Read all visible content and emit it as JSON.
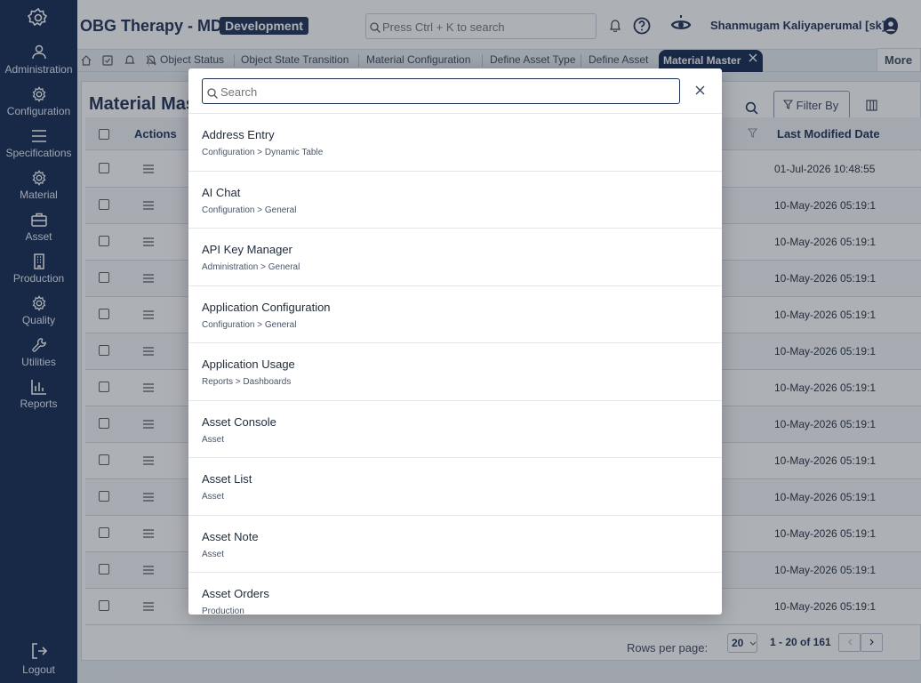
{
  "sidebar": {
    "items": [
      {
        "label": "Administration",
        "icon": "users-icon"
      },
      {
        "label": "Configuration",
        "icon": "gear-icon"
      },
      {
        "label": "Specifications",
        "icon": "list-icon"
      },
      {
        "label": "Material",
        "icon": "gear-icon"
      },
      {
        "label": "Asset",
        "icon": "briefcase-icon"
      },
      {
        "label": "Production",
        "icon": "building-icon"
      },
      {
        "label": "Quality",
        "icon": "gear-icon"
      },
      {
        "label": "Utilities",
        "icon": "wrench-icon"
      },
      {
        "label": "Reports",
        "icon": "bar-chart-icon"
      }
    ],
    "logout": "Logout"
  },
  "header": {
    "title": "OBG Therapy - MD",
    "env_badge": "Development",
    "search_placeholder": "Press Ctrl + K to search",
    "user": "Shanmugam Kaliyaperumal [sk]"
  },
  "tabs": {
    "items": [
      "Object Status",
      "Object State Transition",
      "Material Configuration",
      "Define Asset Type",
      "Define Asset"
    ],
    "active": "Material Master",
    "more": "More"
  },
  "page": {
    "title": "Material Master",
    "filter_label": "Filter By",
    "columns": {
      "actions": "Actions",
      "last_modified": "Last Modified Date"
    },
    "rows": [
      "01-Jul-2026 10:48:55",
      "10-May-2026 05:19:1",
      "10-May-2026 05:19:1",
      "10-May-2026 05:19:1",
      "10-May-2026 05:19:1",
      "10-May-2026 05:19:1",
      "10-May-2026 05:19:1",
      "10-May-2026 05:19:1",
      "10-May-2026 05:19:1",
      "10-May-2026 05:19:1",
      "10-May-2026 05:19:1",
      "10-May-2026 05:19:1",
      "10-May-2026 05:19:1"
    ],
    "pagination": {
      "rows_per_page_label": "Rows per page:",
      "rows_per_page": "20",
      "range": "1 - 20 of 161"
    }
  },
  "modal": {
    "search_placeholder": "Search",
    "results": [
      {
        "title": "Address Entry",
        "path": "Configuration > Dynamic Table"
      },
      {
        "title": "AI Chat",
        "path": "Configuration > General"
      },
      {
        "title": "API Key Manager",
        "path": "Administration > General"
      },
      {
        "title": "Application Configuration",
        "path": "Configuration > General"
      },
      {
        "title": "Application Usage",
        "path": "Reports > Dashboards"
      },
      {
        "title": "Asset Console",
        "path": "Asset"
      },
      {
        "title": "Asset List",
        "path": "Asset"
      },
      {
        "title": "Asset Note",
        "path": "Asset"
      },
      {
        "title": "Asset Orders",
        "path": "Production"
      }
    ]
  },
  "colors": {
    "sidebar_bg": "#0f2650",
    "accent": "#1a2d52"
  }
}
